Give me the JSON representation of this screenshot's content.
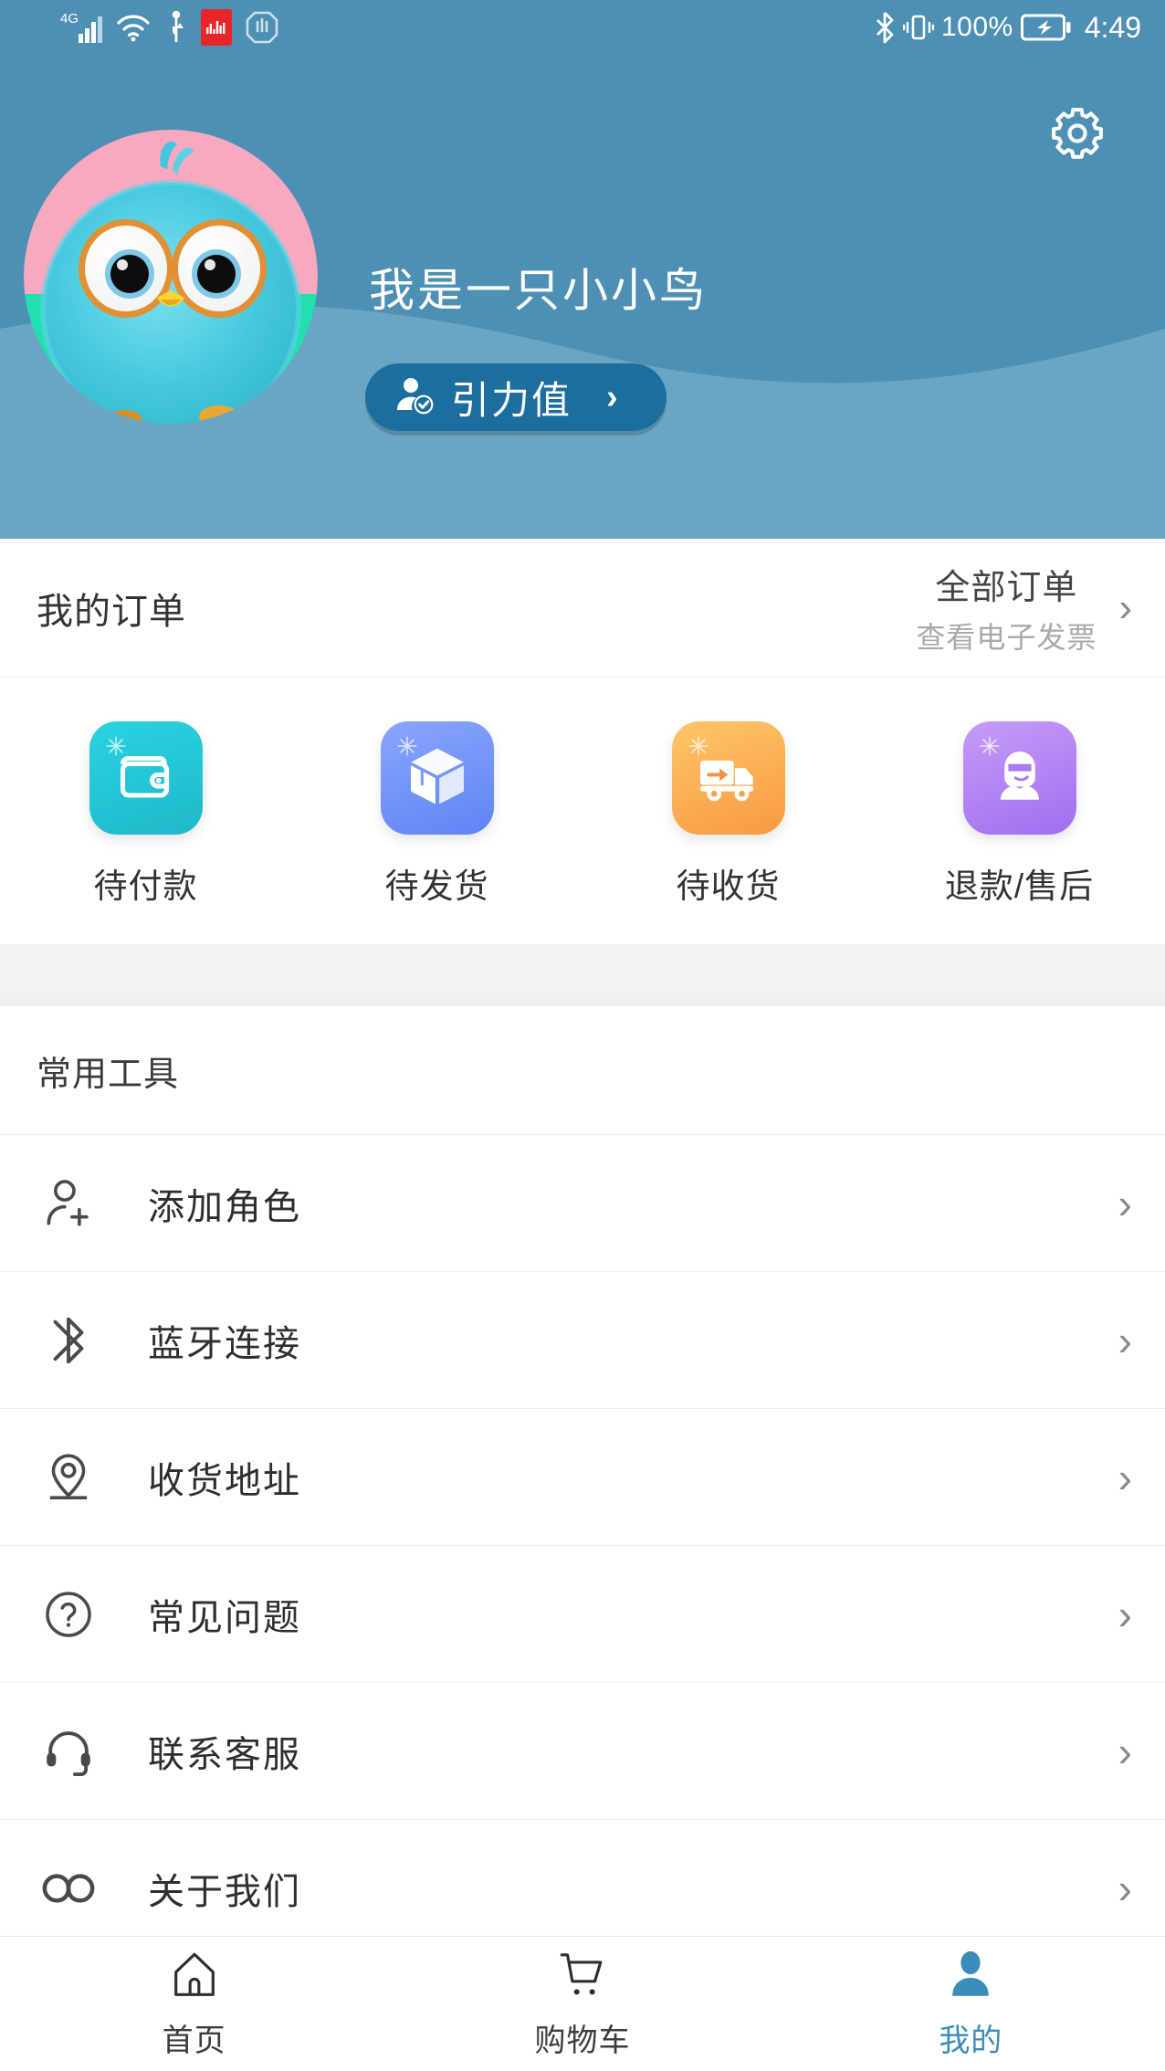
{
  "status_bar": {
    "network": "4G",
    "icons_left": [
      "signal-bars-icon",
      "wifi-icon",
      "usb-icon",
      "recording-app-icon",
      "stop-hand-icon"
    ],
    "icons_right": [
      "bluetooth-icon",
      "vibrate-icon",
      "battery-charging-icon"
    ],
    "battery_percent": "100%",
    "time": "4:49"
  },
  "header": {
    "username": "我是一只小小鸟",
    "gravity_button_label": "引力值",
    "gravity_button_arrow": "›",
    "settings_icon": "gear-icon",
    "bg_color_top": "#4d90b4",
    "bg_color_bottom": "#6aa5c4",
    "gravity_btn_color": "#1b6e9e"
  },
  "orders": {
    "title": "我的订单",
    "all_orders_label": "全部订单",
    "e_invoice_label": "查看电子发票",
    "chevron": "›",
    "items": [
      {
        "label": "待付款",
        "icon": "wallet-icon",
        "color_from": "#2ad3e0",
        "color_to": "#1fb8c9"
      },
      {
        "label": "待发货",
        "icon": "package-box-icon",
        "color_from": "#7d9bfb",
        "color_to": "#5f84f5"
      },
      {
        "label": "待收货",
        "icon": "delivery-truck-icon",
        "color_from": "#ffc062",
        "color_to": "#f99a43"
      },
      {
        "label": "退款/售后",
        "icon": "customer-service-agent-icon",
        "color_from": "#c08ef5",
        "color_to": "#a06ef0"
      }
    ]
  },
  "tools": {
    "title": "常用工具",
    "chevron": "›",
    "items": [
      {
        "label": "添加角色",
        "icon": "person-add-icon"
      },
      {
        "label": "蓝牙连接",
        "icon": "bluetooth-icon"
      },
      {
        "label": "收货地址",
        "icon": "location-pin-icon"
      },
      {
        "label": "常见问题",
        "icon": "question-circle-icon"
      },
      {
        "label": "联系客服",
        "icon": "headset-icon"
      },
      {
        "label": "关于我们",
        "icon": "infinity-icon"
      }
    ]
  },
  "bottom_nav": {
    "active_color": "#3b8cba",
    "items": [
      {
        "label": "首页",
        "icon": "home-icon",
        "active": false
      },
      {
        "label": "购物车",
        "icon": "shopping-cart-icon",
        "active": false
      },
      {
        "label": "我的",
        "icon": "person-icon",
        "active": true
      }
    ]
  }
}
